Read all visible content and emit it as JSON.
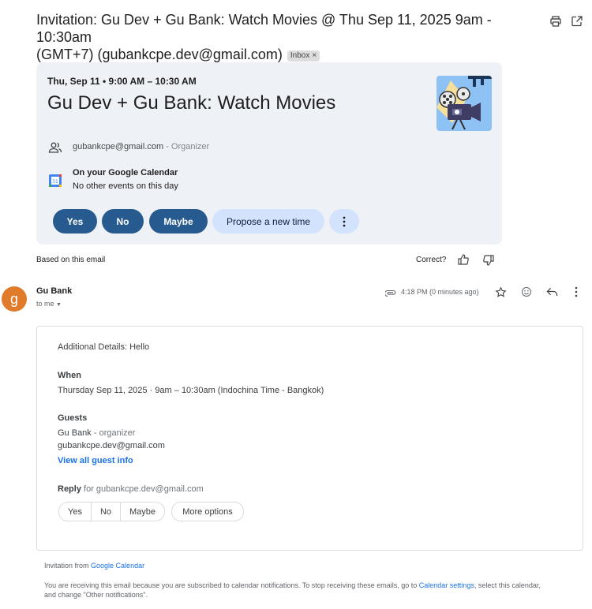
{
  "subject": {
    "line1": "Invitation: Gu Dev + Gu Bank: Watch Movies @ Thu Sep 11, 2025 9am - 10:30am",
    "line2": "(GMT+7) (gubankcpe.dev@gmail.com)",
    "label": "Inbox",
    "label_remove": "×"
  },
  "top_icons": [
    "print-icon",
    "open-in-new-window-icon"
  ],
  "event_card": {
    "date": "Thu, Sep 11 • 9:00 AM – 10:30 AM",
    "title": "Gu Dev + Gu Bank: Watch Movies",
    "organizer_email": "gubankcpe@gmail.com",
    "organizer_role": " - Organizer",
    "calendar_title": "On your Google Calendar",
    "calendar_sub": "No other events on this day",
    "buttons": {
      "yes": "Yes",
      "no": "No",
      "maybe": "Maybe",
      "propose": "Propose a new time"
    }
  },
  "feedback": {
    "based_on": "Based on this email",
    "correct": "Correct?"
  },
  "message": {
    "avatar_letter": "g",
    "sender": "Gu Bank",
    "to": "to me",
    "time": "4:18 PM (0 minutes ago)"
  },
  "invite": {
    "details": "Additional Details: Hello",
    "when_label": "When",
    "when_value": "Thursday Sep 11, 2025 · 9am – 10:30am (Indochina Time - Bangkok)",
    "guests_label": "Guests",
    "guest1_name": "Gu Bank",
    "guest1_role": " - organizer",
    "guest2": "gubankcpe.dev@gmail.com",
    "view_all": "View all guest info",
    "reply_label": "Reply",
    "reply_for": " for gubankcpe.dev@gmail.com",
    "rsvp": {
      "yes": "Yes",
      "no": "No",
      "maybe": "Maybe"
    },
    "more_options": "More options"
  },
  "footer": {
    "invitation_from": "Invitation from ",
    "google_calendar": "Google Calendar",
    "notice_1": "You are receiving this email because you are subscribed to calendar notifications. To stop receiving these emails, go to ",
    "calendar_settings": "Calendar settings",
    "notice_2": ", select this calendar,",
    "notice_3": "and change \"Other notifications\"."
  }
}
